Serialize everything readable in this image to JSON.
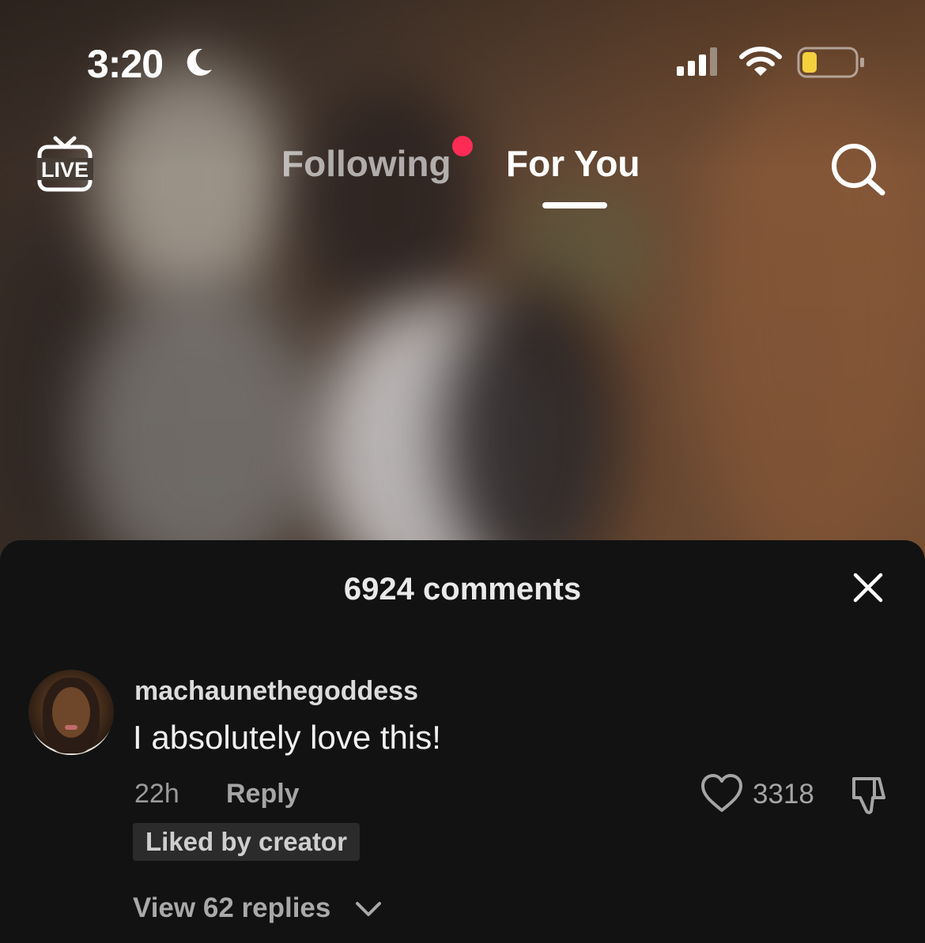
{
  "status_bar": {
    "time": "3:20",
    "icons": [
      "moon-icon",
      "cellular-signal-icon",
      "wifi-icon",
      "battery-icon"
    ],
    "battery_color": "#f4d03f"
  },
  "top_nav": {
    "live_label": "LIVE",
    "tabs": [
      {
        "label": "Following",
        "active": false,
        "has_notification": true
      },
      {
        "label": "For You",
        "active": true
      }
    ],
    "notification_color": "#fe2c55"
  },
  "comments": {
    "title": "6924 comments",
    "items": [
      {
        "username": "machaunethegoddess",
        "text": "I absolutely love this!",
        "time_ago": "22h",
        "reply_label": "Reply",
        "like_count": "3318",
        "badge": "Liked by creator",
        "view_replies": "View 62 replies"
      }
    ]
  }
}
